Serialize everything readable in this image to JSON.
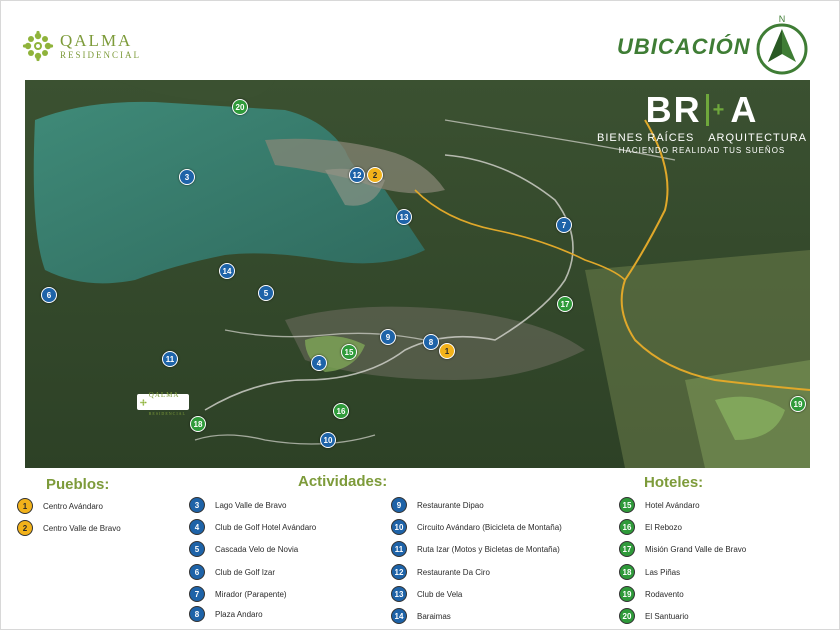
{
  "header": {
    "logo_name": "QALMA",
    "logo_sub": "RESIDENCIAL",
    "title": "UBICACIÓN",
    "compass_letter": "N"
  },
  "map": {
    "overlay_logo": {
      "main_left": "BR",
      "main_right": "A",
      "plus": "+",
      "line_left": "BIENES RAÍCES",
      "line_right": "ARQUITECTURA",
      "tagline": "HACIENDO REALIDAD TUS SUEÑOS"
    },
    "inset_logo_name": "QALMA",
    "inset_logo_sub": "RESIDENCIAL",
    "colors": {
      "water": "#3a7a6a",
      "forest": "#2f4a2c",
      "town": "#8a8778",
      "road": "#e0a82a",
      "path": "#d6d6cf"
    }
  },
  "legend": {
    "pueblos_title": "Pueblos:",
    "actividades_title": "Actividades:",
    "hoteles_title": "Hoteles:",
    "pueblos": [
      {
        "n": "1",
        "label": "Centro Avándaro"
      },
      {
        "n": "2",
        "label": "Centro Valle de Bravo"
      }
    ],
    "actividades_a": [
      {
        "n": "3",
        "label": "Lago Valle de Bravo"
      },
      {
        "n": "4",
        "label": "Club de Golf Hotel Avándaro"
      },
      {
        "n": "5",
        "label": "Cascada Velo de Novia"
      },
      {
        "n": "6",
        "label": "Club de Golf Izar"
      },
      {
        "n": "7",
        "label": "Mirador (Parapente)"
      },
      {
        "n": "8",
        "label": "Plaza Andaro"
      }
    ],
    "actividades_b": [
      {
        "n": "9",
        "label": "Restaurante Dipao"
      },
      {
        "n": "10",
        "label": "Circuito Avándaro (Bicicleta de Montaña)"
      },
      {
        "n": "11",
        "label": "Ruta Izar (Motos y Bicletas de Montaña)"
      },
      {
        "n": "12",
        "label": "Restaurante Da Ciro"
      },
      {
        "n": "13",
        "label": "Club de Vela"
      },
      {
        "n": "14",
        "label": "Baraimas"
      }
    ],
    "hoteles": [
      {
        "n": "15",
        "label": "Hotel Avándaro"
      },
      {
        "n": "16",
        "label": "El Rebozo"
      },
      {
        "n": "17",
        "label": "Misión Grand Valle de Bravo"
      },
      {
        "n": "18",
        "label": "Las Piñas"
      },
      {
        "n": "19",
        "label": "Rodavento"
      },
      {
        "n": "20",
        "label": "El Santuario"
      }
    ]
  }
}
